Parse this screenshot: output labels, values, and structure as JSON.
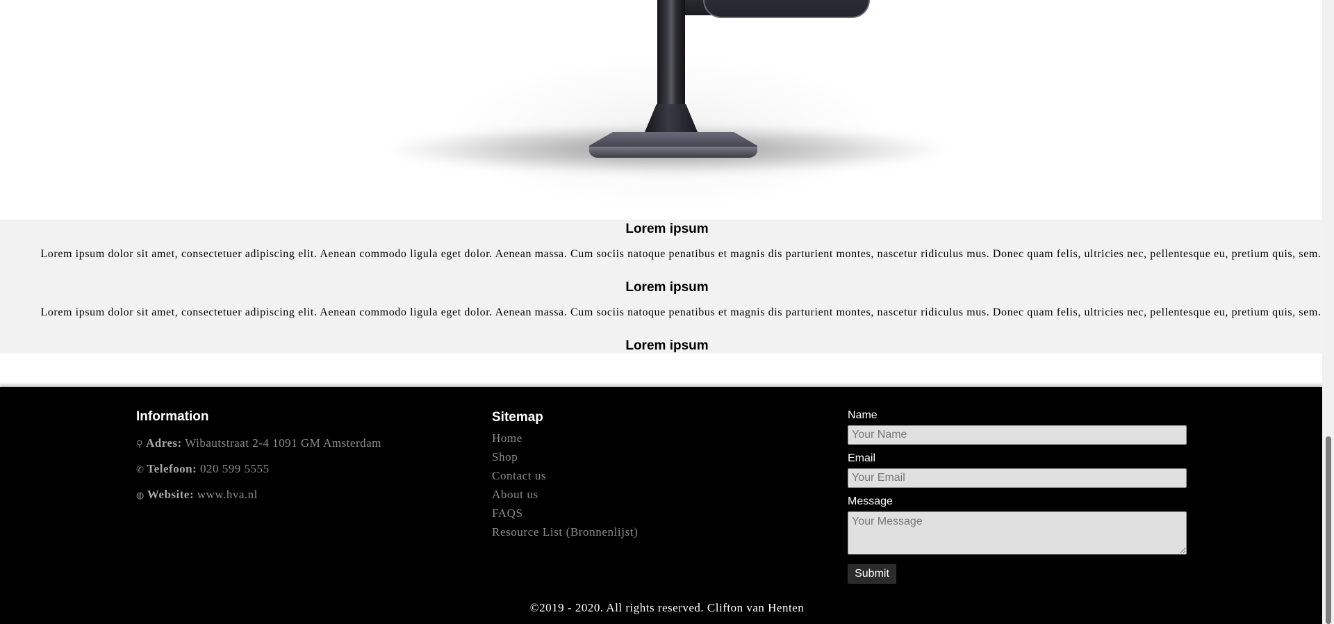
{
  "content": {
    "sections": [
      {
        "title": "Lorem ipsum",
        "text": "Lorem ipsum dolor sit amet, consectetuer adipiscing elit. Aenean commodo ligula eget dolor. Aenean massa. Cum sociis natoque penatibus et magnis dis parturient montes, nascetur ridiculus mus. Donec quam felis, ultricies nec, pellentesque eu, pretium quis, sem."
      },
      {
        "title": "Lorem ipsum",
        "text": "Lorem ipsum dolor sit amet, consectetuer adipiscing elit. Aenean commodo ligula eget dolor. Aenean massa. Cum sociis natoque penatibus et magnis dis parturient montes, nascetur ridiculus mus. Donec quam felis, ultricies nec, pellentesque eu, pretium quis, sem."
      },
      {
        "title": "Lorem ipsum"
      }
    ]
  },
  "footer": {
    "information": {
      "title": "Information",
      "address": {
        "icon": "map-pin-icon",
        "label": "Adres:",
        "value": "Wibautstraat 2-4 1091 GM Amsterdam"
      },
      "phone": {
        "icon": "phone-icon",
        "label": "Telefoon:",
        "value": "020 599 5555"
      },
      "website": {
        "icon": "globe-icon",
        "label": "Website:",
        "value": "www.hva.nl"
      }
    },
    "sitemap": {
      "title": "Sitemap",
      "links": [
        "Home",
        "Shop",
        "Contact us",
        "About us",
        "FAQS",
        "Resource List (Bronnenlijst)"
      ]
    },
    "form": {
      "name_label": "Name",
      "name_placeholder": "Your Name",
      "email_label": "Email",
      "email_placeholder": "Your Email",
      "message_label": "Message",
      "message_placeholder": "Your Message",
      "submit_label": "Submit"
    },
    "copyright": "©2019 - 2020. All rights reserved. Clifton van Henten"
  },
  "colors": {
    "footer_bg": "#000000",
    "section_bg": "#f2f2f2",
    "link_color": "#8c8c8c"
  }
}
